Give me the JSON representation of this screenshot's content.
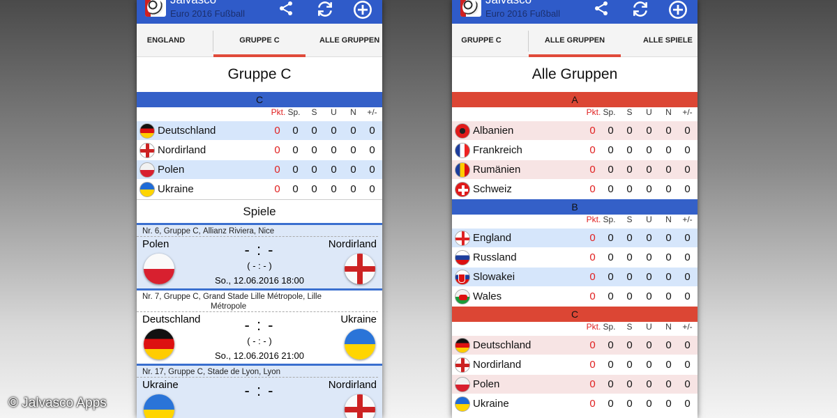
{
  "app": {
    "title": "Jalvasco",
    "subtitle": "Euro 2016 Fußball"
  },
  "icons": {
    "share": "share-icon",
    "refresh": "refresh-icon",
    "add": "add-circle-icon"
  },
  "colors": {
    "appbar": "#2f5bc9",
    "tab_indicator": "#e04a3a",
    "group_blue": "#3460c8",
    "group_red": "#dc4634"
  },
  "columns": {
    "pkt": "Pkt.",
    "sp": "Sp.",
    "s": "S",
    "u": "U",
    "n": "N",
    "diff": "+/-"
  },
  "left": {
    "tabs": [
      "ENGLAND",
      "GRUPPE C",
      "ALLE GRUPPEN"
    ],
    "active_tab": "GRUPPE C",
    "page_title": "Gruppe C",
    "group": "C",
    "table": [
      {
        "team": "Deutschland",
        "pkt": "0",
        "sp": "0",
        "s": "0",
        "u": "0",
        "n": "0",
        "diff": "0"
      },
      {
        "team": "Nordirland",
        "pkt": "0",
        "sp": "0",
        "s": "0",
        "u": "0",
        "n": "0",
        "diff": "0"
      },
      {
        "team": "Polen",
        "pkt": "0",
        "sp": "0",
        "s": "0",
        "u": "0",
        "n": "0",
        "diff": "0"
      },
      {
        "team": "Ukraine",
        "pkt": "0",
        "sp": "0",
        "s": "0",
        "u": "0",
        "n": "0",
        "diff": "0"
      }
    ],
    "games_title": "Spiele",
    "matches": [
      {
        "nr": "Nr. 6,",
        "group": "Gruppe C,",
        "venue": "Allianz Riviera, Nice",
        "venue2": "",
        "home": "Polen",
        "away": "Nordirland",
        "score": "- : -",
        "halftime": "( - : - )",
        "date": "So., 12.06.2016 18:00"
      },
      {
        "nr": "Nr. 7,",
        "group": "Gruppe C,",
        "venue": "Grand Stade Lille Métropole, Lille",
        "venue2": "Métropole",
        "home": "Deutschland",
        "away": "Ukraine",
        "score": "- : -",
        "halftime": "( - : - )",
        "date": "So., 12.06.2016 21:00"
      },
      {
        "nr": "Nr. 17,",
        "group": "Gruppe C,",
        "venue": "Stade de Lyon, Lyon",
        "venue2": "",
        "home": "Ukraine",
        "away": "Nordirland",
        "score": "- : -",
        "halftime": "",
        "date": ""
      }
    ]
  },
  "right": {
    "tabs": [
      "GRUPPE C",
      "ALLE GRUPPEN",
      "ALLE SPIELE"
    ],
    "active_tab": "ALLE GRUPPEN",
    "page_title": "Alle Gruppen",
    "groups": [
      {
        "name": "A",
        "teams": [
          {
            "team": "Albanien",
            "pkt": "0",
            "sp": "0",
            "s": "0",
            "u": "0",
            "n": "0",
            "diff": "0"
          },
          {
            "team": "Frankreich",
            "pkt": "0",
            "sp": "0",
            "s": "0",
            "u": "0",
            "n": "0",
            "diff": "0"
          },
          {
            "team": "Rumänien",
            "pkt": "0",
            "sp": "0",
            "s": "0",
            "u": "0",
            "n": "0",
            "diff": "0"
          },
          {
            "team": "Schweiz",
            "pkt": "0",
            "sp": "0",
            "s": "0",
            "u": "0",
            "n": "0",
            "diff": "0"
          }
        ]
      },
      {
        "name": "B",
        "teams": [
          {
            "team": "England",
            "pkt": "0",
            "sp": "0",
            "s": "0",
            "u": "0",
            "n": "0",
            "diff": "0"
          },
          {
            "team": "Russland",
            "pkt": "0",
            "sp": "0",
            "s": "0",
            "u": "0",
            "n": "0",
            "diff": "0"
          },
          {
            "team": "Slowakei",
            "pkt": "0",
            "sp": "0",
            "s": "0",
            "u": "0",
            "n": "0",
            "diff": "0"
          },
          {
            "team": "Wales",
            "pkt": "0",
            "sp": "0",
            "s": "0",
            "u": "0",
            "n": "0",
            "diff": "0"
          }
        ]
      },
      {
        "name": "C",
        "teams": [
          {
            "team": "Deutschland",
            "pkt": "0",
            "sp": "0",
            "s": "0",
            "u": "0",
            "n": "0",
            "diff": "0"
          },
          {
            "team": "Nordirland",
            "pkt": "0",
            "sp": "0",
            "s": "0",
            "u": "0",
            "n": "0",
            "diff": "0"
          },
          {
            "team": "Polen",
            "pkt": "0",
            "sp": "0",
            "s": "0",
            "u": "0",
            "n": "0",
            "diff": "0"
          },
          {
            "team": "Ukraine",
            "pkt": "0",
            "sp": "0",
            "s": "0",
            "u": "0",
            "n": "0",
            "diff": "0"
          }
        ]
      }
    ]
  },
  "watermark": "© Jalvasco Apps"
}
